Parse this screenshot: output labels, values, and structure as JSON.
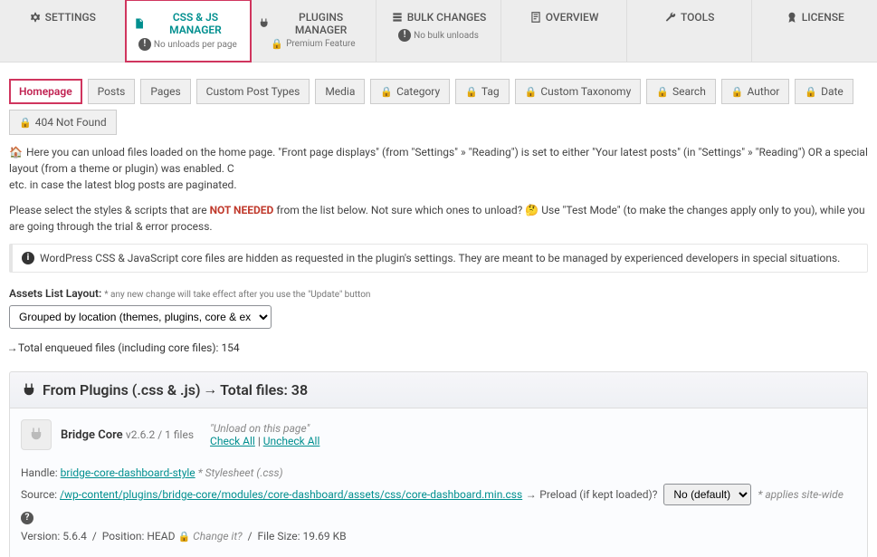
{
  "topnav": [
    {
      "id": "settings",
      "title": "SETTINGS",
      "sub": "",
      "icon": "gear"
    },
    {
      "id": "cssjs",
      "title": "CSS & JS MANAGER",
      "sub": "No unloads per page",
      "icon": "doc",
      "subicon": "info"
    },
    {
      "id": "plugins",
      "title": "PLUGINS MANAGER",
      "sub": "Premium Feature",
      "icon": "plug",
      "subicon": "lock"
    },
    {
      "id": "bulk",
      "title": "BULK CHANGES",
      "sub": "No bulk unloads",
      "icon": "stack",
      "subicon": "info"
    },
    {
      "id": "overview",
      "title": "OVERVIEW",
      "sub": "",
      "icon": "page"
    },
    {
      "id": "tools",
      "title": "TOOLS",
      "sub": "",
      "icon": "wrench"
    },
    {
      "id": "license",
      "title": "LICENSE",
      "sub": "",
      "icon": "badge"
    }
  ],
  "subtabs": [
    {
      "id": "homepage",
      "label": "Homepage",
      "locked": false
    },
    {
      "id": "posts",
      "label": "Posts",
      "locked": false
    },
    {
      "id": "pages",
      "label": "Pages",
      "locked": false
    },
    {
      "id": "cpt",
      "label": "Custom Post Types",
      "locked": false
    },
    {
      "id": "media",
      "label": "Media",
      "locked": false
    },
    {
      "id": "category",
      "label": "Category",
      "locked": true
    },
    {
      "id": "tag",
      "label": "Tag",
      "locked": true
    },
    {
      "id": "customtax",
      "label": "Custom Taxonomy",
      "locked": true
    },
    {
      "id": "search",
      "label": "Search",
      "locked": true
    },
    {
      "id": "author",
      "label": "Author",
      "locked": true
    },
    {
      "id": "date",
      "label": "Date",
      "locked": true
    },
    {
      "id": "notfound",
      "label": "404 Not Found",
      "locked": true
    }
  ],
  "intro": {
    "line1a": "Here you can unload files loaded on the home page. \"Front page displays\" (from \"Settings\" » \"Reading\") is set to either \"Your latest posts\" (in \"Settings\" » \"Reading\") OR a special layout (from a theme or plugin) was enabled. C",
    "line1b": "etc. in case the latest blog posts are paginated.",
    "line2a": "Please select the styles & scripts that are ",
    "notneeded": "NOT NEEDED",
    "line2b": " from the list below. Not sure which ones to unload? ",
    "line2c": " Use \"Test Mode\" (to make the changes apply only to you), while you are going through the trial & error process."
  },
  "notice": "WordPress CSS & JavaScript core files are hidden as requested in the plugin's settings. They are meant to be managed by experienced developers in special situations.",
  "layout": {
    "label": "Assets List Layout:",
    "hint": "* any new change will take effect after you use the \"Update\" button",
    "selected": "Grouped by location (themes, plugins, core & external)"
  },
  "total_line": "Total enqueued files (including core files): 154",
  "section": {
    "title": "From Plugins (.css & .js)",
    "total_label": "Total files: 38"
  },
  "plugin": {
    "name": "Bridge Core",
    "version": "v2.6.2",
    "filecount": "1 files",
    "unload_heading": "\"Unload on this page\"",
    "check_all": "Check All",
    "uncheck_all": "Uncheck All"
  },
  "asset": {
    "handle_label": "Handle:",
    "handle": "bridge-core-dashboard-style",
    "type": "* Stylesheet (.css)",
    "source_label": "Source:",
    "source": "/wp-content/plugins/bridge-core/modules/core-dashboard/assets/css/core-dashboard.min.css",
    "preload_label": "Preload (if kept loaded)?",
    "preload_selected": "No (default)",
    "applies": "* applies site-wide",
    "version_label": "Version:",
    "version": "5.6.4",
    "position_label": "Position:",
    "position": "HEAD",
    "changeit": "Change it?",
    "filesize_label": "File Size:",
    "filesize": "19.69 KB"
  }
}
